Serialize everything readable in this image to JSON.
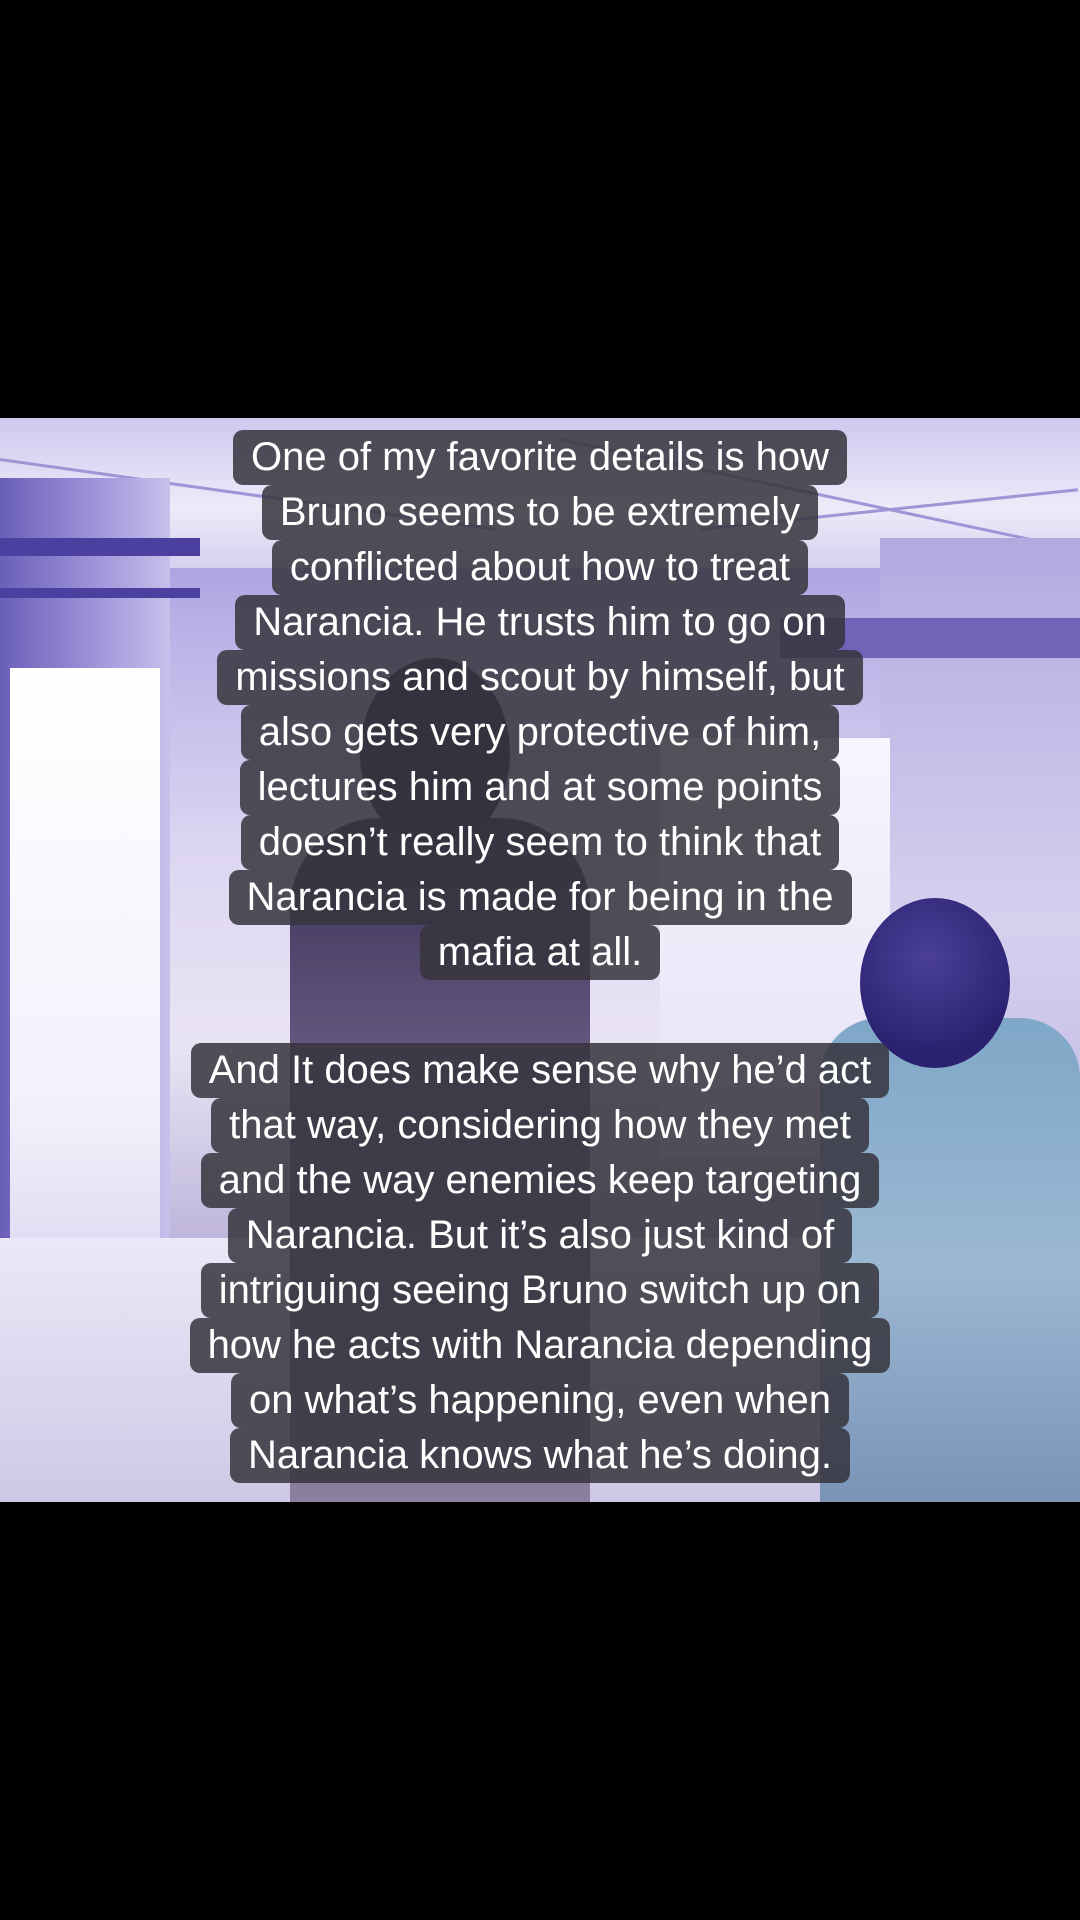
{
  "captions": [
    {
      "lines": [
        "One of my favorite details is how",
        "Bruno seems to be extremely",
        "conflicted about how to treat",
        "Narancia. He trusts him to go on",
        "missions and scout by himself, but",
        "also gets very protective of him,",
        "lectures him and at some points",
        "doesn’t really seem to think that",
        "Narancia is made for being in the",
        "mafia at all."
      ]
    },
    {
      "lines": [
        "And It does make sense why he’d act",
        "that way, considering how they met",
        "and the way enemies keep targeting",
        "Narancia. But it’s also just kind of",
        "intriguing seeing Bruno switch up on",
        "how he acts with Narancia depending",
        "on what’s happening, even when",
        "Narancia knows what he’s doing."
      ]
    }
  ],
  "colors": {
    "letterbox": "#000000",
    "caption_bg": "#37343e",
    "caption_text": "#ffffff",
    "scene_tint": "#8e82d0"
  }
}
